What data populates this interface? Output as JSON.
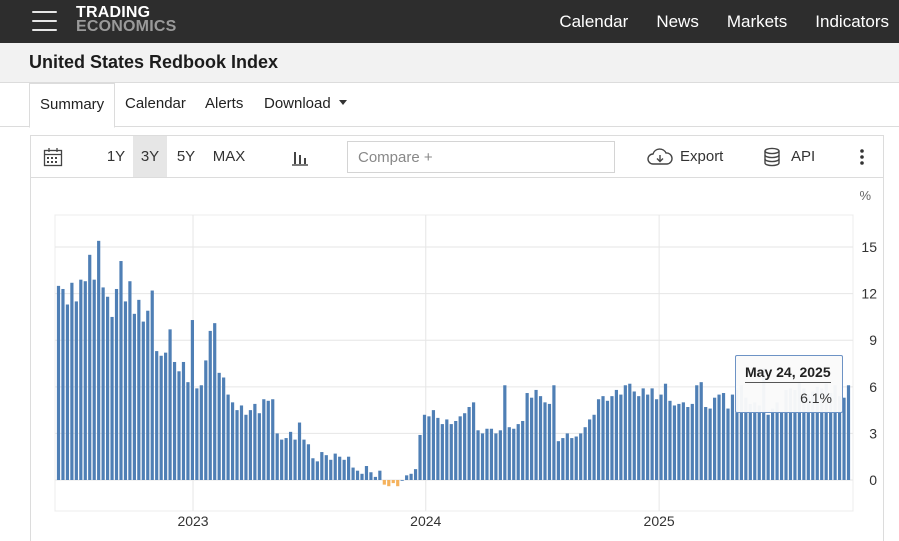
{
  "header": {
    "logo_line1": "TRADING",
    "logo_line2": "ECONOMICS",
    "nav": [
      "Calendar",
      "News",
      "Markets",
      "Indicators"
    ]
  },
  "page_title": "United States Redbook Index",
  "tabs": {
    "summary": "Summary",
    "calendar": "Calendar",
    "alerts": "Alerts",
    "download": "Download"
  },
  "toolbar": {
    "ranges": [
      "1Y",
      "3Y",
      "5Y",
      "MAX"
    ],
    "selected_range": "3Y",
    "compare_placeholder": "Compare +",
    "export_label": "Export",
    "api_label": "API"
  },
  "tooltip": {
    "date": "May 24, 2025",
    "value": "6.1%"
  },
  "colors": {
    "bar": "#4f7fb5",
    "negative_bar": "#f5b25c",
    "nav_bg": "#2d2d2d",
    "grid": "#e6e6e6"
  },
  "chart_data": {
    "type": "bar",
    "title": "",
    "xlabel": "",
    "ylabel": "%",
    "ylim": [
      -2,
      17
    ],
    "yticks": [
      0,
      3,
      6,
      9,
      12,
      15
    ],
    "xticks": [
      "2023",
      "2024",
      "2025"
    ],
    "grid": true,
    "legend": "none",
    "x_start": "2022-06-04",
    "interval_days": 7,
    "values": [
      12.5,
      12.3,
      11.3,
      12.7,
      11.5,
      12.9,
      12.8,
      14.5,
      12.9,
      15.4,
      12.4,
      11.8,
      10.5,
      12.3,
      14.1,
      11.5,
      12.8,
      10.7,
      11.6,
      10.2,
      10.9,
      12.2,
      8.3,
      8.0,
      8.2,
      9.7,
      7.6,
      7.0,
      7.6,
      6.3,
      10.3,
      5.9,
      6.1,
      7.7,
      9.6,
      10.1,
      6.9,
      6.6,
      5.5,
      5.0,
      4.5,
      4.8,
      4.2,
      4.5,
      4.9,
      4.3,
      5.2,
      5.1,
      5.2,
      3.0,
      2.6,
      2.7,
      3.1,
      2.6,
      3.7,
      2.6,
      2.3,
      1.4,
      1.2,
      1.8,
      1.6,
      1.3,
      1.7,
      1.5,
      1.3,
      1.5,
      0.8,
      0.6,
      0.4,
      0.9,
      0.5,
      0.2,
      0.6,
      -0.3,
      -0.4,
      -0.2,
      -0.4,
      0.0,
      0.3,
      0.4,
      0.7,
      2.9,
      4.2,
      4.1,
      4.5,
      4.0,
      3.6,
      3.9,
      3.6,
      3.8,
      4.1,
      4.3,
      4.7,
      5.0,
      3.2,
      3.0,
      3.3,
      3.3,
      3.0,
      3.2,
      6.1,
      3.4,
      3.3,
      3.6,
      3.8,
      5.6,
      5.3,
      5.8,
      5.4,
      5.0,
      4.9,
      6.1,
      2.5,
      2.7,
      3.0,
      2.7,
      2.8,
      3.0,
      3.4,
      3.9,
      4.2,
      5.2,
      5.4,
      5.1,
      5.4,
      5.8,
      5.5,
      6.1,
      6.2,
      5.7,
      5.4,
      5.9,
      5.5,
      5.9,
      5.2,
      5.5,
      6.2,
      5.1,
      4.8,
      4.9,
      5.0,
      4.7,
      4.9,
      6.1,
      6.3,
      4.7,
      4.6,
      5.3,
      5.5,
      5.6,
      4.6,
      5.5,
      5.8,
      6.1,
      5.3,
      4.9,
      5.0,
      4.8,
      7.2,
      4.2,
      4.6,
      5.0,
      4.4,
      5.8,
      5.9,
      5.8,
      6.3,
      5.9,
      5.5,
      5.7,
      6.0,
      5.9,
      6.2,
      5.6,
      6.1,
      5.4,
      5.3,
      6.1
    ]
  }
}
